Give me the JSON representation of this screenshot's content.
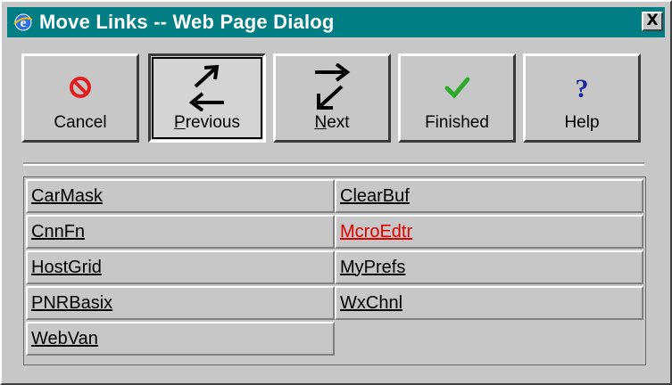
{
  "window": {
    "title": "Move Links -- Web Page Dialog",
    "close_label": "X",
    "title_bar_color": "#007e84",
    "icon": "ie-icon"
  },
  "toolbar": {
    "buttons": [
      {
        "label_before": "",
        "label_underlined": "",
        "label_after": "Cancel",
        "icon": "cancel-icon",
        "pressed": false
      },
      {
        "label_before": "",
        "label_underlined": "P",
        "label_after": "revious",
        "icon": "previous-arrows-icon",
        "pressed": true
      },
      {
        "label_before": "",
        "label_underlined": "N",
        "label_after": "ext",
        "icon": "next-arrows-icon",
        "pressed": false
      },
      {
        "label_before": "",
        "label_underlined": "",
        "label_after": "Finished",
        "icon": "checkmark-icon",
        "pressed": false
      },
      {
        "label_before": "",
        "label_underlined": "",
        "label_after": "Help",
        "icon": "help-icon",
        "pressed": false
      }
    ]
  },
  "links": {
    "rows": [
      [
        {
          "text": "CarMask",
          "color": "#000000"
        },
        {
          "text": "ClearBuf",
          "color": "#000000"
        }
      ],
      [
        {
          "text": "CnnFn",
          "color": "#000000"
        },
        {
          "text": "McroEdtr",
          "color": "#e00000"
        }
      ],
      [
        {
          "text": "HostGrid",
          "color": "#000000"
        },
        {
          "text": "MyPrefs",
          "color": "#000000"
        }
      ],
      [
        {
          "text": "PNRBasix",
          "color": "#000000"
        },
        {
          "text": "WxChnl",
          "color": "#000000"
        }
      ],
      [
        {
          "text": "WebVan",
          "color": "#000000"
        },
        {
          "text": "",
          "color": "#000000"
        }
      ]
    ]
  }
}
